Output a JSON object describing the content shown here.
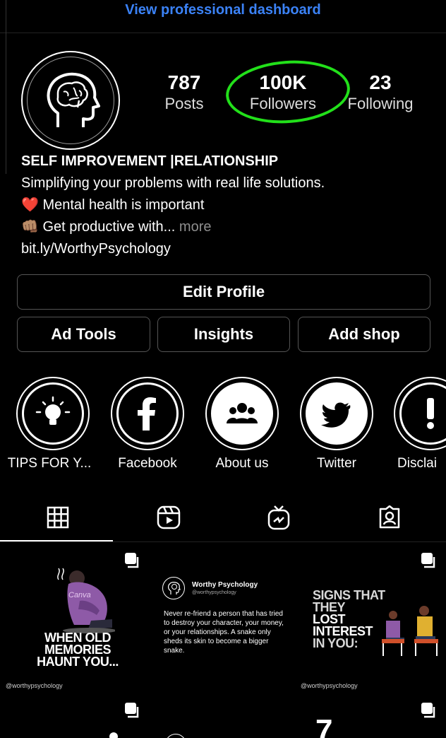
{
  "header": {
    "dashboard_link": "View professional dashboard"
  },
  "profile": {
    "stats": [
      {
        "value": "787",
        "label": "Posts"
      },
      {
        "value": "100K",
        "label": "Followers"
      },
      {
        "value": "23",
        "label": "Following"
      }
    ],
    "bio": {
      "name": "SELF IMPROVEMENT |RELATIONSHIP",
      "line1": "Simplifying your problems with real life solutions.",
      "line2": "Mental health is important",
      "line3": "Get productive with...",
      "more": "more",
      "link": "bit.ly/WorthyPsychology"
    },
    "emoji": {
      "heart": "❤️",
      "fist": "👊🏽"
    }
  },
  "buttons": {
    "edit_profile": "Edit Profile",
    "ad_tools": "Ad Tools",
    "insights": "Insights",
    "add_shop": "Add shop"
  },
  "highlights": [
    {
      "label": "TIPS FOR Y...",
      "icon": "lightbulb-icon"
    },
    {
      "label": "Facebook",
      "icon": "facebook-icon"
    },
    {
      "label": "About us",
      "icon": "group-icon"
    },
    {
      "label": "Twitter",
      "icon": "twitter-icon"
    },
    {
      "label": "Disclai",
      "icon": "exclamation-icon"
    }
  ],
  "tabs": [
    "grid-icon",
    "reels-icon",
    "igtv-icon",
    "tagged-icon"
  ],
  "posts": {
    "post1": {
      "line1a": "WHEN ",
      "line1b": "OLD",
      "line2": "MEMORIES",
      "line3": "HAUNT YOU...",
      "watermark": "Canva",
      "handle": "@worthypsychology"
    },
    "post2": {
      "title": "Worthy Psychology",
      "subtitle": "@worthypsychology",
      "quote": "Never re-friend a person that has tried to destroy your character, your money, or your relationships. A snake only sheds its skin to become a bigger snake."
    },
    "post3": {
      "line1": "SIGNS THAT",
      "line2": "THEY",
      "line3": "LOST",
      "line4": "INTEREST",
      "line5": "IN YOU:",
      "handle": "@worthypsychology"
    },
    "post6": {
      "partial_text": "7"
    }
  },
  "colors": {
    "accent_blue": "#3b82f6",
    "highlight_green": "#22e01a",
    "card_purple": "#8e5aa7"
  }
}
